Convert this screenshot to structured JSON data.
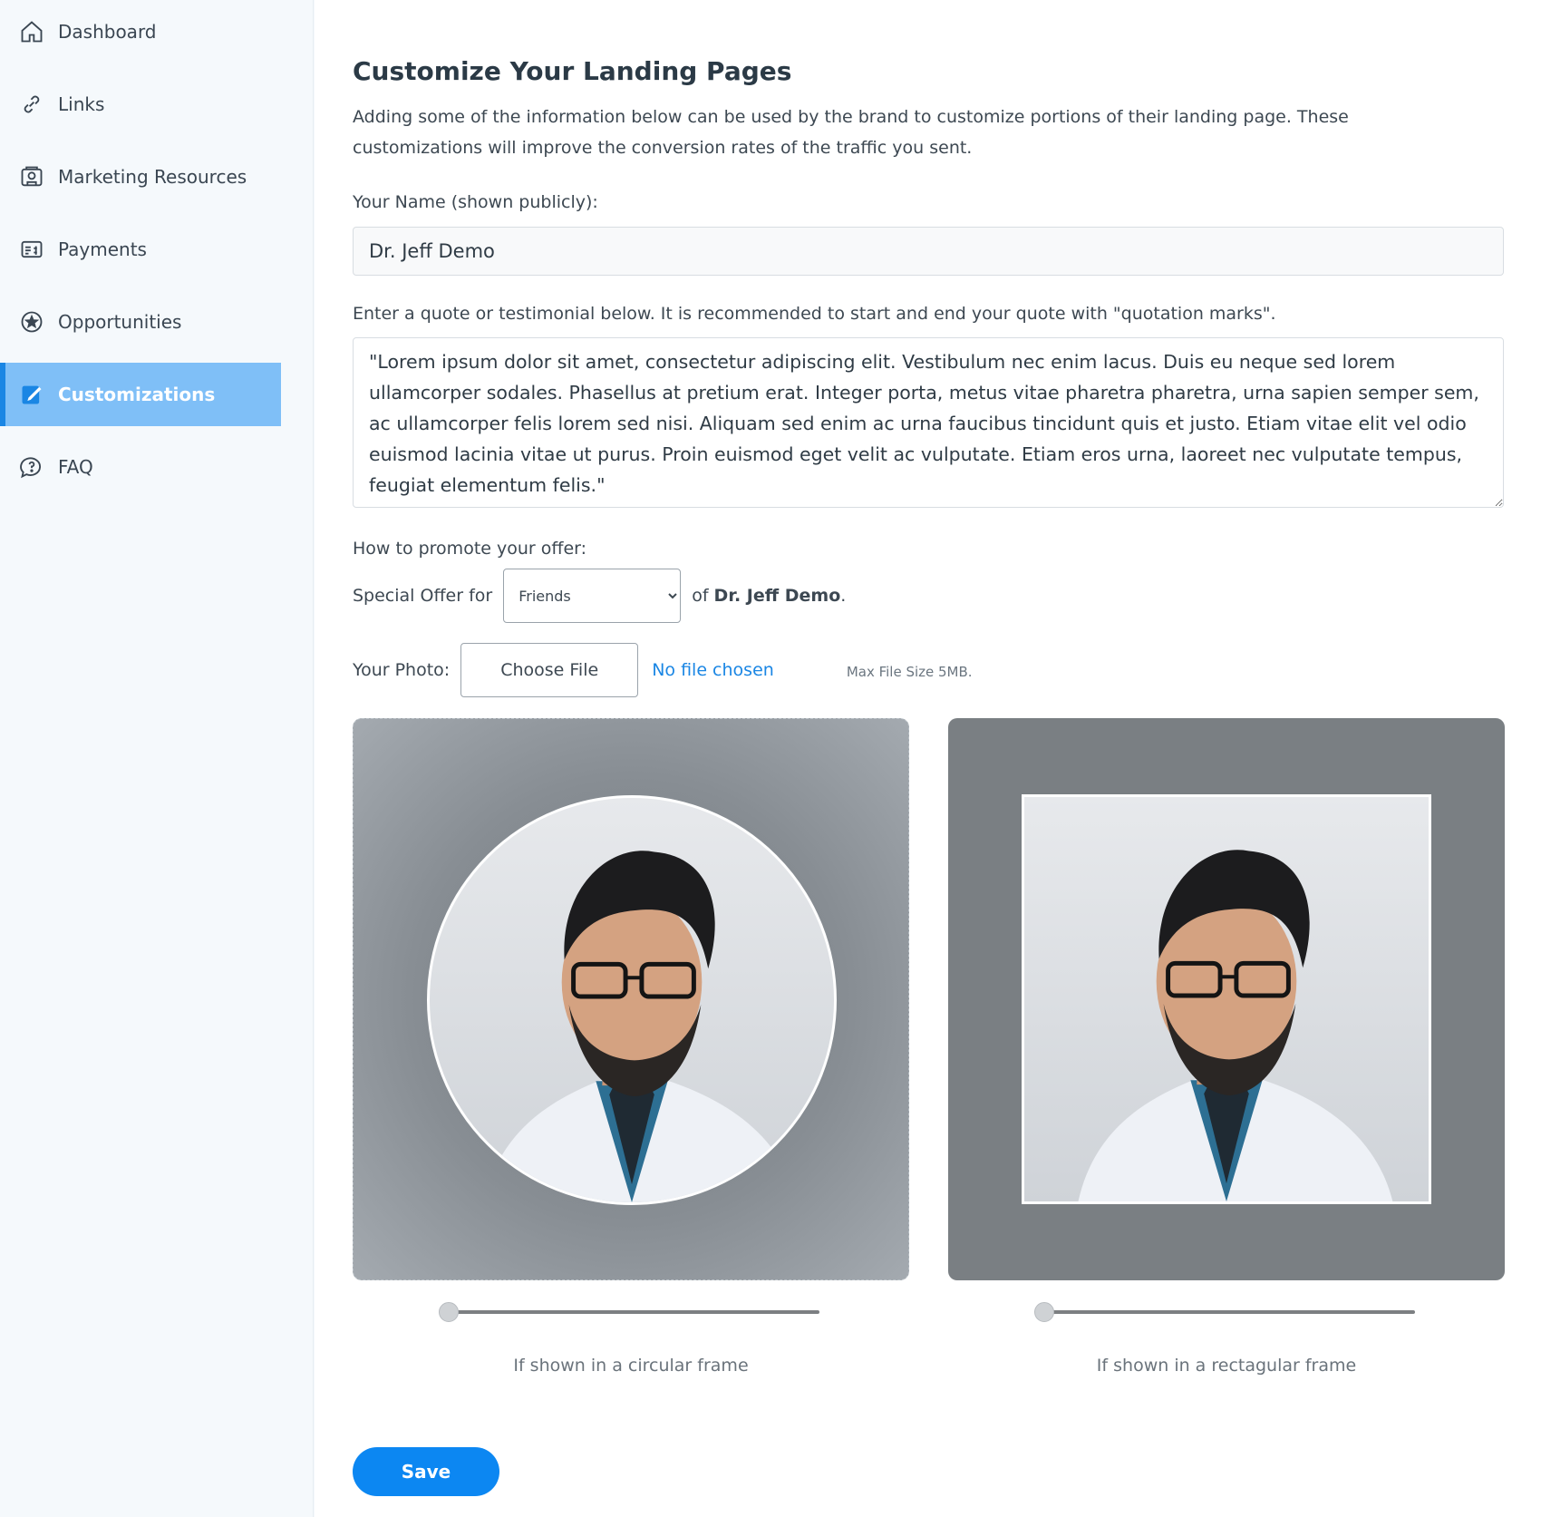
{
  "sidebar": {
    "items": [
      {
        "label": "Dashboard",
        "icon": "home-icon"
      },
      {
        "label": "Links",
        "icon": "link-icon"
      },
      {
        "label": "Marketing Resources",
        "icon": "marketing-icon"
      },
      {
        "label": "Payments",
        "icon": "payments-icon"
      },
      {
        "label": "Opportunities",
        "icon": "star-icon"
      },
      {
        "label": "Customizations",
        "icon": "edit-icon",
        "active": true
      },
      {
        "label": "FAQ",
        "icon": "faq-icon"
      }
    ]
  },
  "main": {
    "title": "Customize Your Landing Pages",
    "description": "Adding some of the information below can be used by the brand to customize portions of their landing page. These customizations will improve the conversion rates of the traffic you sent.",
    "name_label": "Your Name (shown publicly):",
    "name_value": "Dr. Jeff Demo",
    "quote_label": "Enter a quote or testimonial below. It is recommended to start and end your quote with \"quotation marks\".",
    "quote_value": "\"Lorem ipsum dolor sit amet, consectetur adipiscing elit. Vestibulum nec enim lacus. Duis eu neque sed lorem ullamcorper sodales. Phasellus at pretium erat. Integer porta, metus vitae pharetra pharetra, urna sapien semper sem, ac ullamcorper felis lorem sed nisi. Aliquam sed enim ac urna faucibus tincidunt quis et justo. Etiam vitae elit vel odio euismod lacinia vitae ut purus. Proin euismod eget velit ac vulputate. Etiam eros urna, laoreet nec vulputate tempus, feugiat elementum felis.\"",
    "promote_label": "How to promote your offer:",
    "offer_prefix": "Special Offer for",
    "offer_selected": "Friends",
    "offer_of": "of",
    "offer_name": "Dr. Jeff Demo",
    "offer_suffix": ".",
    "photo_label": "Your Photo:",
    "choose_file_label": "Choose File",
    "no_file_label": "No file chosen",
    "max_size_label": "Max File Size 5MB.",
    "circular_caption": "If shown in a circular frame",
    "rect_caption": "If shown in a rectagular frame",
    "circular_zoom": 0,
    "rect_zoom": 0,
    "save_label": "Save"
  },
  "colors": {
    "accent": "#0c87f2",
    "active_nav": "#7fbff7",
    "link": "#1a86e4"
  }
}
